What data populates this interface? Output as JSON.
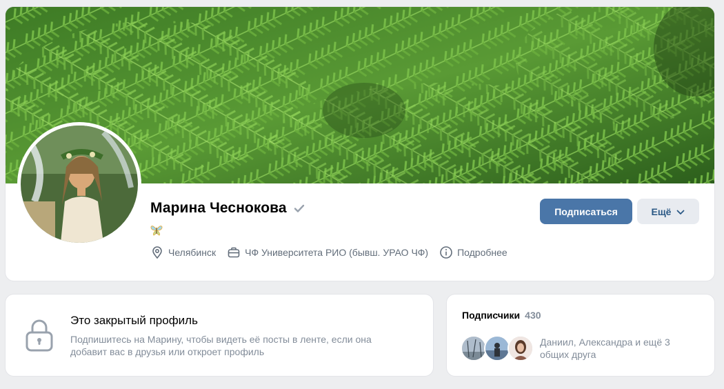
{
  "profile": {
    "name": "Марина Чеснокова",
    "status_emoji": "butterfly",
    "info": {
      "city": "Челябинск",
      "university": "ЧФ Университета РИО (бывш. УРАО ЧФ)",
      "more": "Подробнее"
    },
    "buttons": {
      "subscribe": "Подписаться",
      "more": "Ещё"
    }
  },
  "closed_profile": {
    "title": "Это закрытый профиль",
    "description": "Подпишитесь на Марину, чтобы видеть её посты в ленте, если она добавит вас в друзья или откроет профиль"
  },
  "followers": {
    "title": "Подписчики",
    "count": "430",
    "mutual_text": "Даниил, Александра и ещё 3 общих друга"
  },
  "colors": {
    "accent": "#4a76a8",
    "page_bg": "#edeef0",
    "secondary_text": "#828c99"
  }
}
